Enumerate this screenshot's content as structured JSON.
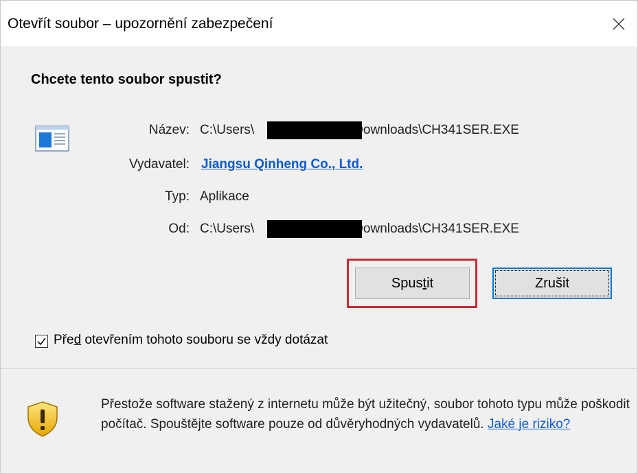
{
  "window": {
    "title": "Otevřít soubor – upozornění zabezpečení"
  },
  "question": "Chcete tento soubor spustit?",
  "fields": {
    "name_label": "Název:",
    "name_value_prefix": "C:\\Users\\",
    "name_value_suffix": "Downloads\\CH341SER.EXE",
    "publisher_label": "Vydavatel:",
    "publisher_value": "Jiangsu Qinheng Co., Ltd.",
    "type_label": "Typ:",
    "type_value": "Aplikace",
    "from_label": "Od:",
    "from_value_prefix": "C:\\Users\\",
    "from_value_suffix": "Downloads\\CH341SER.EXE"
  },
  "buttons": {
    "run_label_pre": "Spus",
    "run_label_accel": "t",
    "run_label_post": "it",
    "cancel_label": "Zrušit"
  },
  "checkbox": {
    "checked": true,
    "label_pre": "Pře",
    "label_accel": "d",
    "label_post": " otevřením tohoto souboru se vždy dotázat"
  },
  "warning": {
    "text": "Přestože software stažený z internetu může být užitečný, soubor tohoto typu může poškodit počítač. Spouštějte software pouze od důvěryhodných vydavatelů.",
    "link": "Jaké je riziko?"
  },
  "colors": {
    "link": "#0b5bd2",
    "highlight": "#cc2a36",
    "focus": "#0078d7"
  }
}
